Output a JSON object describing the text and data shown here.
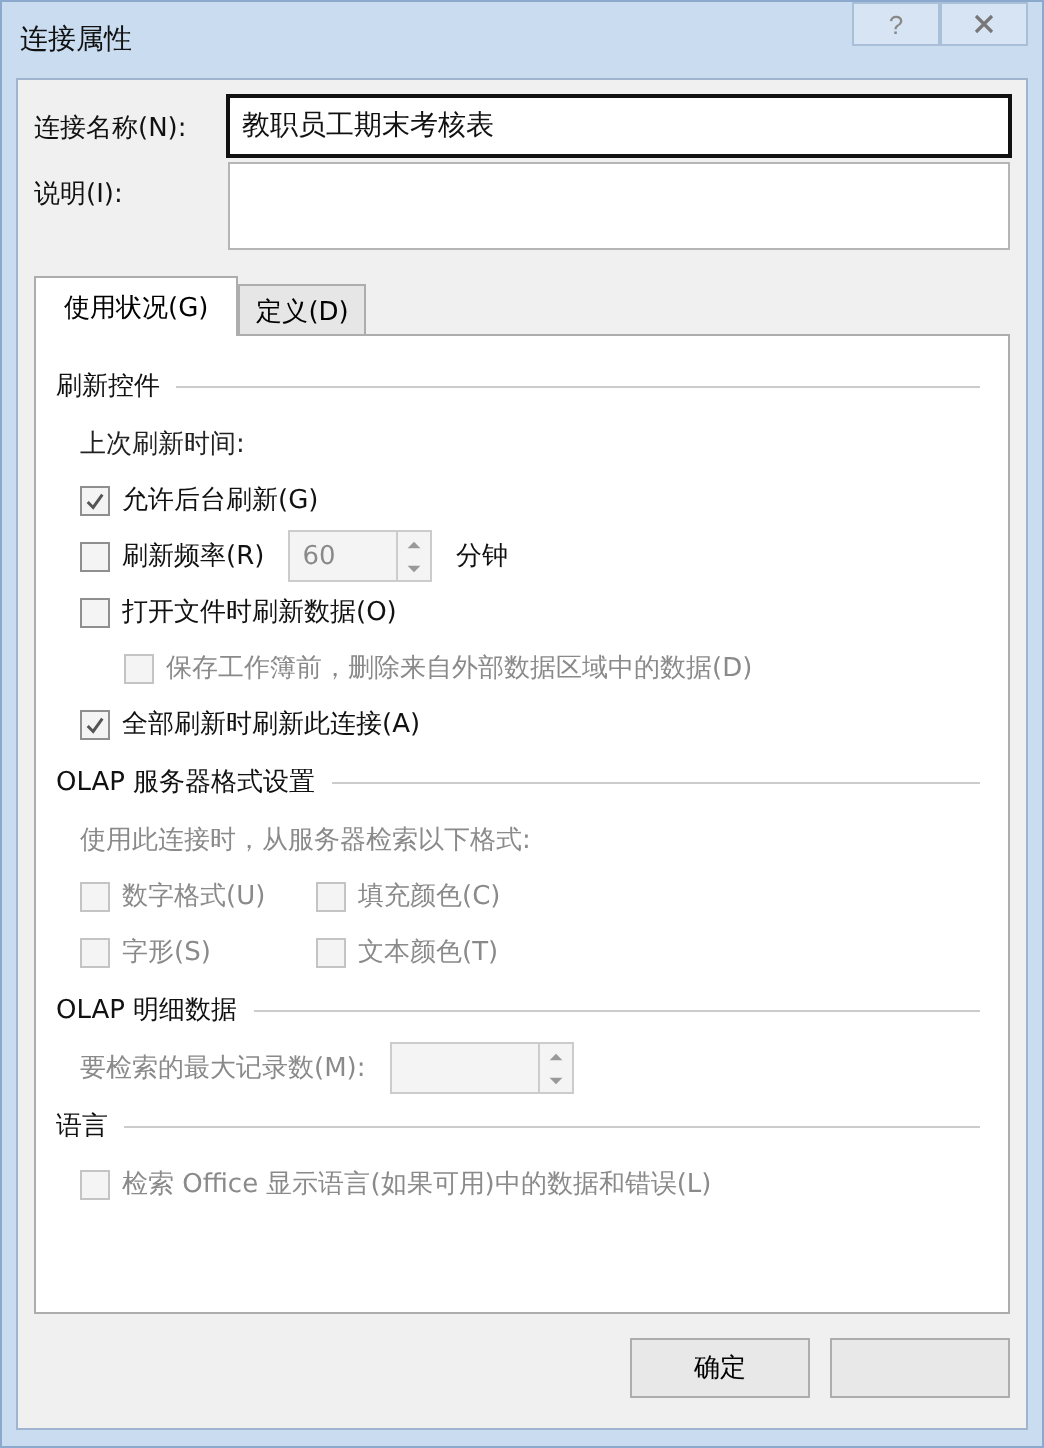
{
  "window": {
    "title": "连接属性",
    "help": "?"
  },
  "name_field": {
    "label": "连接名称(N):",
    "value": "教职员工期末考核表",
    "highlighted": true
  },
  "description_field": {
    "label": "说明(I):"
  },
  "tabs": [
    {
      "label": "使用状况(G)",
      "selected": true
    },
    {
      "label": "定义(D)",
      "selected": false
    }
  ],
  "sections": [
    {
      "title": "刷新控件",
      "items": [
        {
          "kind": "text",
          "text": "上次刷新时间:",
          "disabled": false
        },
        {
          "kind": "checkbox",
          "label": "允许后台刷新(G)",
          "checked": true,
          "disabled": false
        },
        {
          "kind": "checkbox_spin",
          "label": "刷新频率(R)",
          "checked": false,
          "disabled": false,
          "value": "60",
          "unit": "分钟",
          "spin_disabled": true
        },
        {
          "kind": "checkbox",
          "label": "打开文件时刷新数据(O)",
          "checked": false,
          "disabled": false,
          "children": [
            {
              "kind": "checkbox",
              "label": "保存工作簿前，删除来自外部数据区域中的数据(D)",
              "checked": false,
              "disabled": true
            }
          ]
        },
        {
          "kind": "checkbox",
          "label": "全部刷新时刷新此连接(A)",
          "checked": true,
          "disabled": false
        }
      ]
    },
    {
      "title": "OLAP 服务器格式设置",
      "items": [
        {
          "kind": "text",
          "text": "使用此连接时，从服务器检索以下格式:",
          "disabled": true
        },
        {
          "kind": "checkbox_grid",
          "boxes": [
            {
              "label": "数字格式(U)",
              "checked": false,
              "disabled": true
            },
            {
              "label": "填充颜色(C)",
              "checked": false,
              "disabled": true
            },
            {
              "label": "字形(S)",
              "checked": false,
              "disabled": true
            },
            {
              "label": "文本颜色(T)",
              "checked": false,
              "disabled": true
            }
          ]
        }
      ]
    },
    {
      "title": "OLAP 明细数据",
      "items": [
        {
          "kind": "spin",
          "label": "要检索的最大记录数(M):",
          "disabled": true
        }
      ]
    },
    {
      "title": "语言",
      "items": [
        {
          "kind": "checkbox",
          "label": "检索 Office 显示语言(如果可用)中的数据和错误(L)",
          "checked": false,
          "disabled": true
        }
      ]
    }
  ],
  "buttons": [
    {
      "kind": "labeled",
      "label": "确定"
    },
    {
      "kind": "blank"
    }
  ]
}
